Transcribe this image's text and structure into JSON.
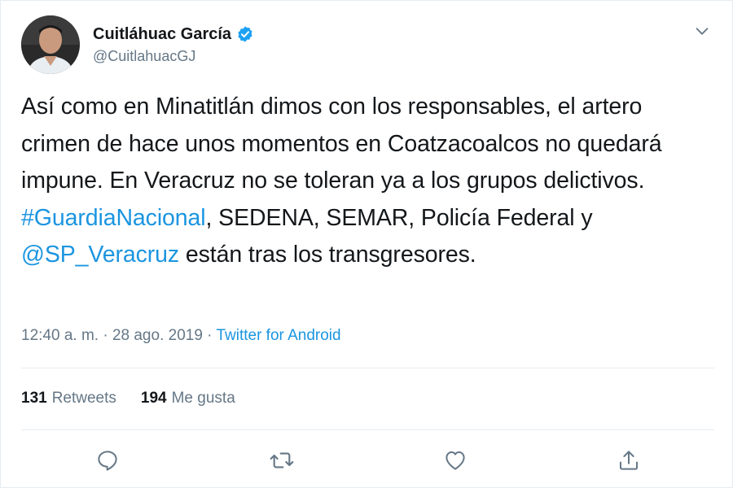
{
  "author": {
    "display_name": "Cuitláhuac García",
    "handle": "@CuitlahuacGJ",
    "verified": true
  },
  "tweet": {
    "text_parts": {
      "p1": "Así como en Minatitlán dimos con los responsables, el artero crimen de hace unos momentos en Coatzacoalcos no quedará impune. En Veracruz no se toleran ya a los grupos delictivos. ",
      "hashtag": "#GuardiaNacional",
      "p2": ", SEDENA, SEMAR, Policía Federal y ",
      "mention": "@SP_Veracruz",
      "p3": " están tras los transgresores."
    },
    "time": "12:40 a. m.",
    "separator1": " · ",
    "date": "28 ago. 2019",
    "separator2": " · ",
    "source": "Twitter for Android"
  },
  "stats": {
    "retweets_count": "131",
    "retweets_label": "Retweets",
    "likes_count": "194",
    "likes_label": "Me gusta"
  },
  "icons": {
    "verified": "verified-badge-icon",
    "menu": "chevron-down-icon",
    "reply": "reply-icon",
    "retweet": "retweet-icon",
    "like": "heart-icon",
    "share": "share-icon"
  },
  "colors": {
    "accent": "#1b95e0",
    "verified": "#1da1f2",
    "text": "#14171a",
    "secondary": "#657786",
    "border": "#e6ecf0"
  }
}
